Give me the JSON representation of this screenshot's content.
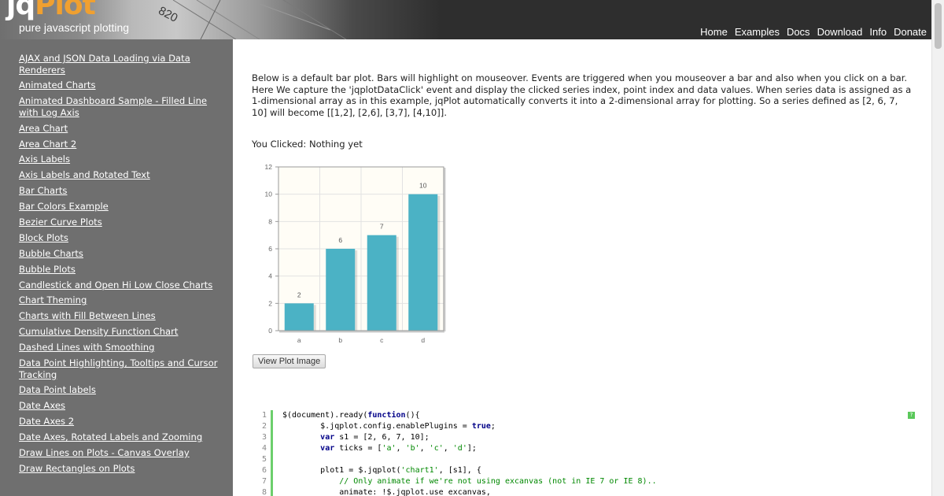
{
  "header": {
    "logo_part1": "jq",
    "logo_part2": "Plot",
    "tagline": "pure javascript plotting",
    "deco_number": "820",
    "nav": [
      "Home",
      "Examples",
      "Docs",
      "Download",
      "Info",
      "Donate"
    ]
  },
  "sidebar": {
    "items": [
      "AJAX and JSON Data Loading via Data Renderers",
      "Animated Charts",
      "Animated Dashboard Sample - Filled Line with Log Axis",
      "Area Chart",
      "Area Chart 2",
      "Axis Labels",
      "Axis Labels and Rotated Text",
      "Bar Charts",
      "Bar Colors Example",
      "Bezier Curve Plots",
      "Block Plots",
      "Bubble Charts",
      "Bubble Plots",
      "Candlestick and Open Hi Low Close Charts",
      "Chart Theming",
      "Charts with Fill Between Lines",
      "Cumulative Density Function Chart",
      "Dashed Lines with Smoothing",
      "Data Point Highlighting, Tooltips and Cursor Tracking",
      "Data Point labels",
      "Date Axes",
      "Date Axes 2",
      "Date Axes, Rotated Labels and Zooming",
      "Draw Lines on Plots - Canvas Overlay",
      "Draw Rectangles on Plots"
    ]
  },
  "main": {
    "intro": "Below is a default bar plot. Bars will highlight on mouseover. Events are triggered when you mouseover a bar and also when you click on a bar. Here We capture the 'jqplotDataClick' event and display the clicked series index, point index and data values. When series data is assigned as a 1-dimensional array as in this example, jqPlot automatically converts it into a 2-dimensional array for plotting. So a series defined as [2, 6, 7, 10] will become [[1,2], [2,6], [3,7], [4,10]].",
    "clicked_text": "You Clicked: Nothing yet",
    "view_button": "View Plot Image"
  },
  "chart_data": {
    "type": "bar",
    "categories": [
      "a",
      "b",
      "c",
      "d"
    ],
    "values": [
      2,
      6,
      7,
      10
    ],
    "ylim": [
      0,
      12
    ],
    "yticks": [
      0,
      2,
      4,
      6,
      8,
      10,
      12
    ],
    "bar_color": "#4bb2c5",
    "background": "#fffdf6",
    "grid": true,
    "data_labels": true
  },
  "code": {
    "lines": [
      {
        "n": "1",
        "text": "$(document).ready(function(){"
      },
      {
        "n": "2",
        "text": "        $.jqplot.config.enablePlugins = true;"
      },
      {
        "n": "3",
        "text": "        var s1 = [2, 6, 7, 10];"
      },
      {
        "n": "4",
        "text": "        var ticks = ['a', 'b', 'c', 'd'];"
      },
      {
        "n": "5",
        "text": ""
      },
      {
        "n": "6",
        "text": "        plot1 = $.jqplot('chart1', [s1], {"
      },
      {
        "n": "7",
        "text": "            // Only animate if we're not using excanvas (not in IE 7 or IE 8).."
      },
      {
        "n": "8",
        "text": "            animate: !$.jqplot.use_excanvas,"
      }
    ],
    "copy_badge": "?"
  },
  "colors": {
    "header_bg": "#2e2e2e",
    "sidebar_bg": "#6f6f6f",
    "logo_accent": "#f0a030",
    "code_gutter": "#6ccf6c"
  }
}
